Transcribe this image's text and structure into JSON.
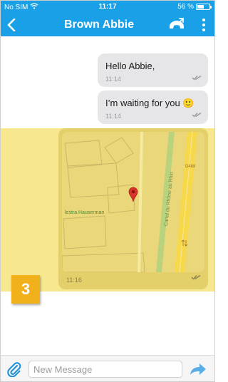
{
  "status_bar": {
    "carrier": "No SIM",
    "time": "11:17",
    "battery_percent": "56 %",
    "battery_level": 0.56
  },
  "header": {
    "back_icon": "chevron-left-icon",
    "title": "Brown Abbie",
    "call_icon": "phone-call-icon",
    "more_icon": "more-vertical-icon",
    "bar_color": "#1aa0e6"
  },
  "messages": [
    {
      "text": "Hello Abbie,",
      "time": "11:14",
      "status_icon": "double-check-icon"
    },
    {
      "text": "I’m waiting for you",
      "emoji": "🙂",
      "time": "11:14",
      "status_icon": "double-check-icon"
    },
    {
      "type": "location",
      "time": "11:16",
      "status_icon": "double-check-icon",
      "map": {
        "place_label": "lestra Hauserman",
        "road_label": "Canal du Rhône au Rhin",
        "road_code": "D468",
        "pin_icon": "map-pin-icon"
      }
    }
  ],
  "badge": {
    "text": "3",
    "color": "#f0b11b"
  },
  "highlight_color": "#f4df64",
  "composer": {
    "attach_icon": "paperclip-icon",
    "placeholder": "New Message",
    "value": "",
    "send_icon": "send-arrow-icon"
  }
}
